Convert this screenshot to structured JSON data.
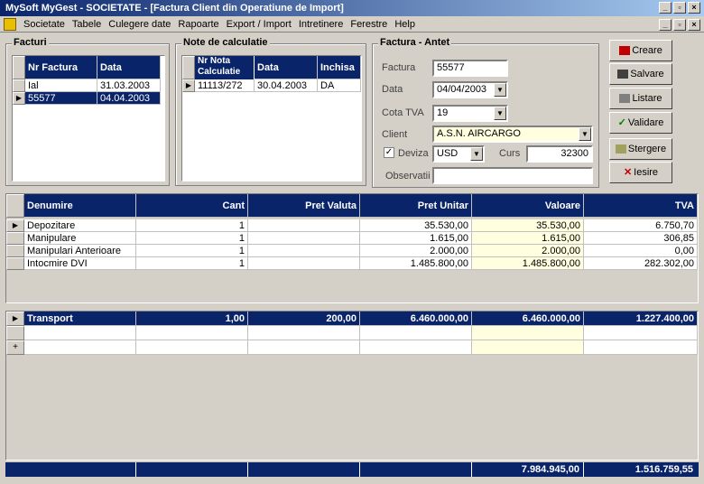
{
  "window": {
    "title": "MySoft MyGest - SOCIETATE - [Factura Client din Operatiune de Import]"
  },
  "menu": [
    "Societate",
    "Tabele",
    "Culegere date",
    "Rapoarte",
    "Export / Import",
    "Intretinere",
    "Ferestre",
    "Help"
  ],
  "facturi": {
    "label": "Facturi",
    "headers": [
      "Nr Factura",
      "Data"
    ],
    "rows": [
      [
        "Ial",
        "31.03.2003"
      ],
      [
        "55577",
        "04.04.2003"
      ]
    ]
  },
  "note": {
    "label": "Note de calculatie",
    "headers": [
      "Nr Nota Calculatie",
      "Data",
      "Inchisa"
    ],
    "rows": [
      [
        "11113/272",
        "30.04.2003",
        "DA"
      ]
    ]
  },
  "antet": {
    "label": "Factura - Antet",
    "factura_label": "Factura",
    "factura": "55577",
    "data_label": "Data",
    "data": "04/04/2003",
    "cota_label": "Cota TVA",
    "cota": "19",
    "client_label": "Client",
    "client": "A.S.N. AIRCARGO",
    "deviza_label": "Deviza",
    "deviza": "USD",
    "curs_label": "Curs",
    "curs": "32300",
    "obs_label": "Observatii",
    "obs": ""
  },
  "buttons": {
    "creare": "Creare",
    "salvare": "Salvare",
    "listare": "Listare",
    "validare": "Validare",
    "stergere": "Stergere",
    "iesire": "Iesire"
  },
  "items": {
    "headers": [
      "Denumire",
      "Cant",
      "Pret Valuta",
      "Pret Unitar",
      "Valoare",
      "TVA"
    ],
    "rows": [
      [
        "Depozitare",
        "1",
        "",
        "35.530,00",
        "35.530,00",
        "6.750,70"
      ],
      [
        "Manipulare",
        "1",
        "",
        "1.615,00",
        "1.615,00",
        "306,85"
      ],
      [
        "Manipulari Anterioare",
        "1",
        "",
        "2.000,00",
        "2.000,00",
        "0,00"
      ],
      [
        "Intocmire DVI",
        "1",
        "",
        "1.485.800,00",
        "1.485.800,00",
        "282.302,00"
      ]
    ]
  },
  "transport": {
    "rows": [
      [
        "Transport",
        "1,00",
        "200,00",
        "6.460.000,00",
        "6.460.000,00",
        "1.227.400,00"
      ]
    ]
  },
  "totals": {
    "valoare": "7.984.945,00",
    "tva": "1.516.759,55"
  }
}
